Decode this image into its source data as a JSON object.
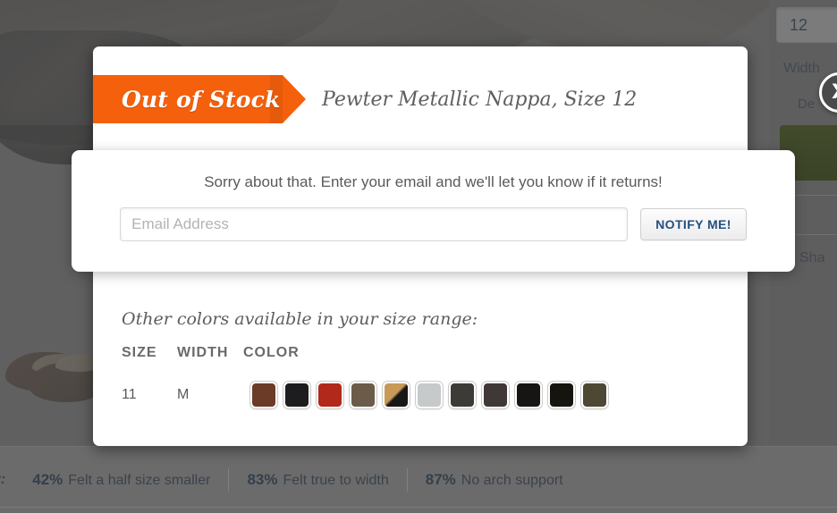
{
  "modal": {
    "status_flag": "Out of Stock",
    "product_variant": "Pewter Metallic Nappa, Size 12",
    "close_label": "X"
  },
  "email_card": {
    "message": "Sorry about that. Enter your email and we'll let you know if it returns!",
    "input_value": "",
    "input_placeholder": "Email Address",
    "submit_label": "NOTIFY ME!"
  },
  "other_colors": {
    "title": "Other colors available in your size range:",
    "headers": {
      "size": "SIZE",
      "width": "WIDTH",
      "color": "COLOR"
    },
    "rows": [
      {
        "size": "11",
        "width": "M",
        "swatches": [
          {
            "name": "brown",
            "color": "#6b3b28"
          },
          {
            "name": "black-textured",
            "color": "#1d1d1f"
          },
          {
            "name": "red",
            "color": "#b2281a"
          },
          {
            "name": "taupe-brown",
            "color": "#6b5b48"
          },
          {
            "name": "tan-black-split",
            "color": "#c79a57",
            "color2": "#171717",
            "split": "diagonal"
          },
          {
            "name": "light-grey",
            "color": "#c7cacb"
          },
          {
            "name": "dark-grey",
            "color": "#3d3b38"
          },
          {
            "name": "dark-brown-grey",
            "color": "#403837"
          },
          {
            "name": "black",
            "color": "#161513"
          },
          {
            "name": "jet-black",
            "color": "#15140f"
          },
          {
            "name": "olive-brown",
            "color": "#4c4833"
          }
        ]
      }
    ]
  },
  "right_rail": {
    "size_value": "12",
    "width_label": "Width",
    "detail_label": "De",
    "share_label": "Sha",
    "accent_green": "#46561f"
  },
  "stats_bar": {
    "lead": "y:",
    "items": [
      {
        "pct": "42%",
        "text": "Felt a half size smaller"
      },
      {
        "pct": "83%",
        "text": "Felt true to width"
      },
      {
        "pct": "87%",
        "text": "No arch support"
      }
    ]
  },
  "colors": {
    "brand_orange": "#f4600c",
    "link_blue": "#24507e",
    "page_grey": "#8d8d8d"
  }
}
